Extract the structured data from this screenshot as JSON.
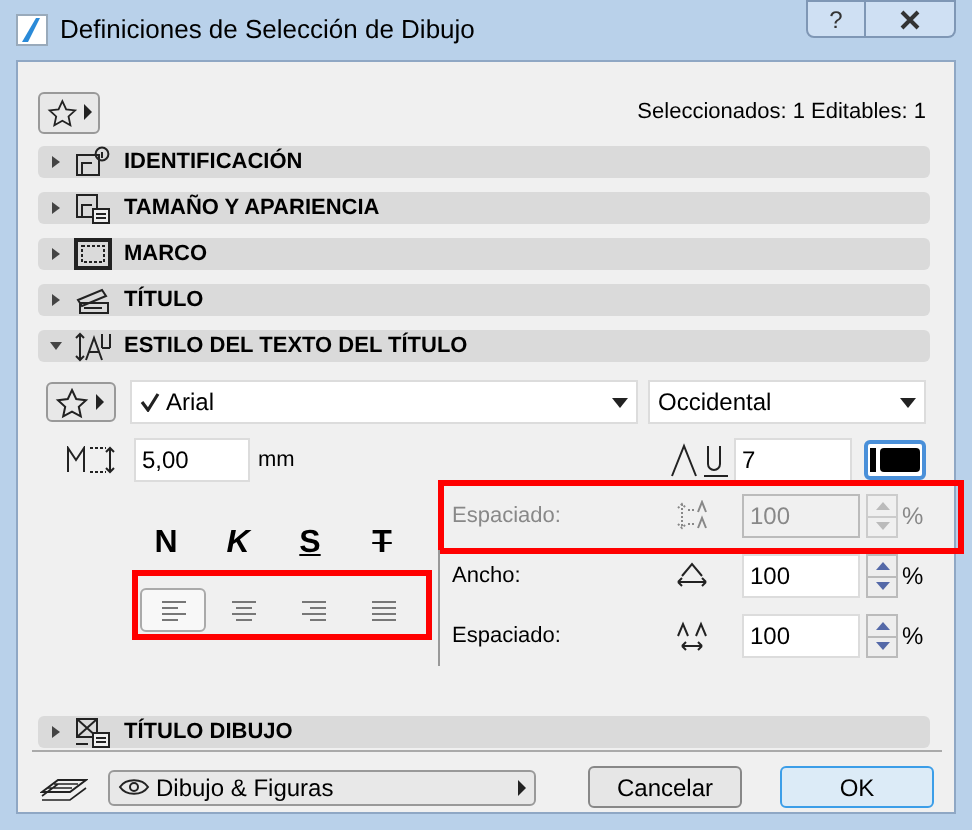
{
  "window": {
    "title": "Definiciones de Selección de Dibujo",
    "help": "?"
  },
  "selection_info": "Seleccionados: 1 Editables: 1",
  "sections": [
    {
      "kind": "id",
      "label": "IDENTIFICACIÓN",
      "expanded": false
    },
    {
      "kind": "size",
      "label": "TAMAÑO Y APARIENCIA",
      "expanded": false
    },
    {
      "kind": "frame",
      "label": "MARCO",
      "expanded": false
    },
    {
      "kind": "title",
      "label": "TÍTULO",
      "expanded": false
    },
    {
      "kind": "textstyle",
      "label": "ESTILO DEL TEXTO DEL TÍTULO",
      "expanded": true
    },
    {
      "kind": "drawingtitle",
      "label": "TÍTULO DIBUJO",
      "expanded": false
    }
  ],
  "text_style": {
    "font": "Arial",
    "font_checked": true,
    "script": "Occidental",
    "size": "5,00",
    "size_unit": "mm",
    "pen": "7",
    "styles": [
      {
        "kind": "bold",
        "label": "N"
      },
      {
        "kind": "italic",
        "label": "K"
      },
      {
        "kind": "underline",
        "label": "S"
      },
      {
        "kind": "strike",
        "label": "T"
      }
    ],
    "alignment": [
      {
        "kind": "left",
        "selected": true
      },
      {
        "kind": "center",
        "selected": false
      },
      {
        "kind": "right",
        "selected": false
      },
      {
        "kind": "justify",
        "selected": false
      }
    ],
    "spacing_rows": [
      {
        "kind": "line",
        "label": "Espaciado:",
        "value": "100",
        "unit": "%",
        "disabled": true
      },
      {
        "kind": "width",
        "label": "Ancho:",
        "value": "100",
        "unit": "%",
        "disabled": false
      },
      {
        "kind": "char",
        "label": "Espaciado:",
        "value": "100",
        "unit": "%",
        "disabled": false
      }
    ]
  },
  "footer": {
    "layer": "Dibujo & Figuras",
    "buttons": [
      {
        "label": "Cancelar",
        "default": false
      },
      {
        "label": "OK",
        "default": true
      }
    ]
  }
}
